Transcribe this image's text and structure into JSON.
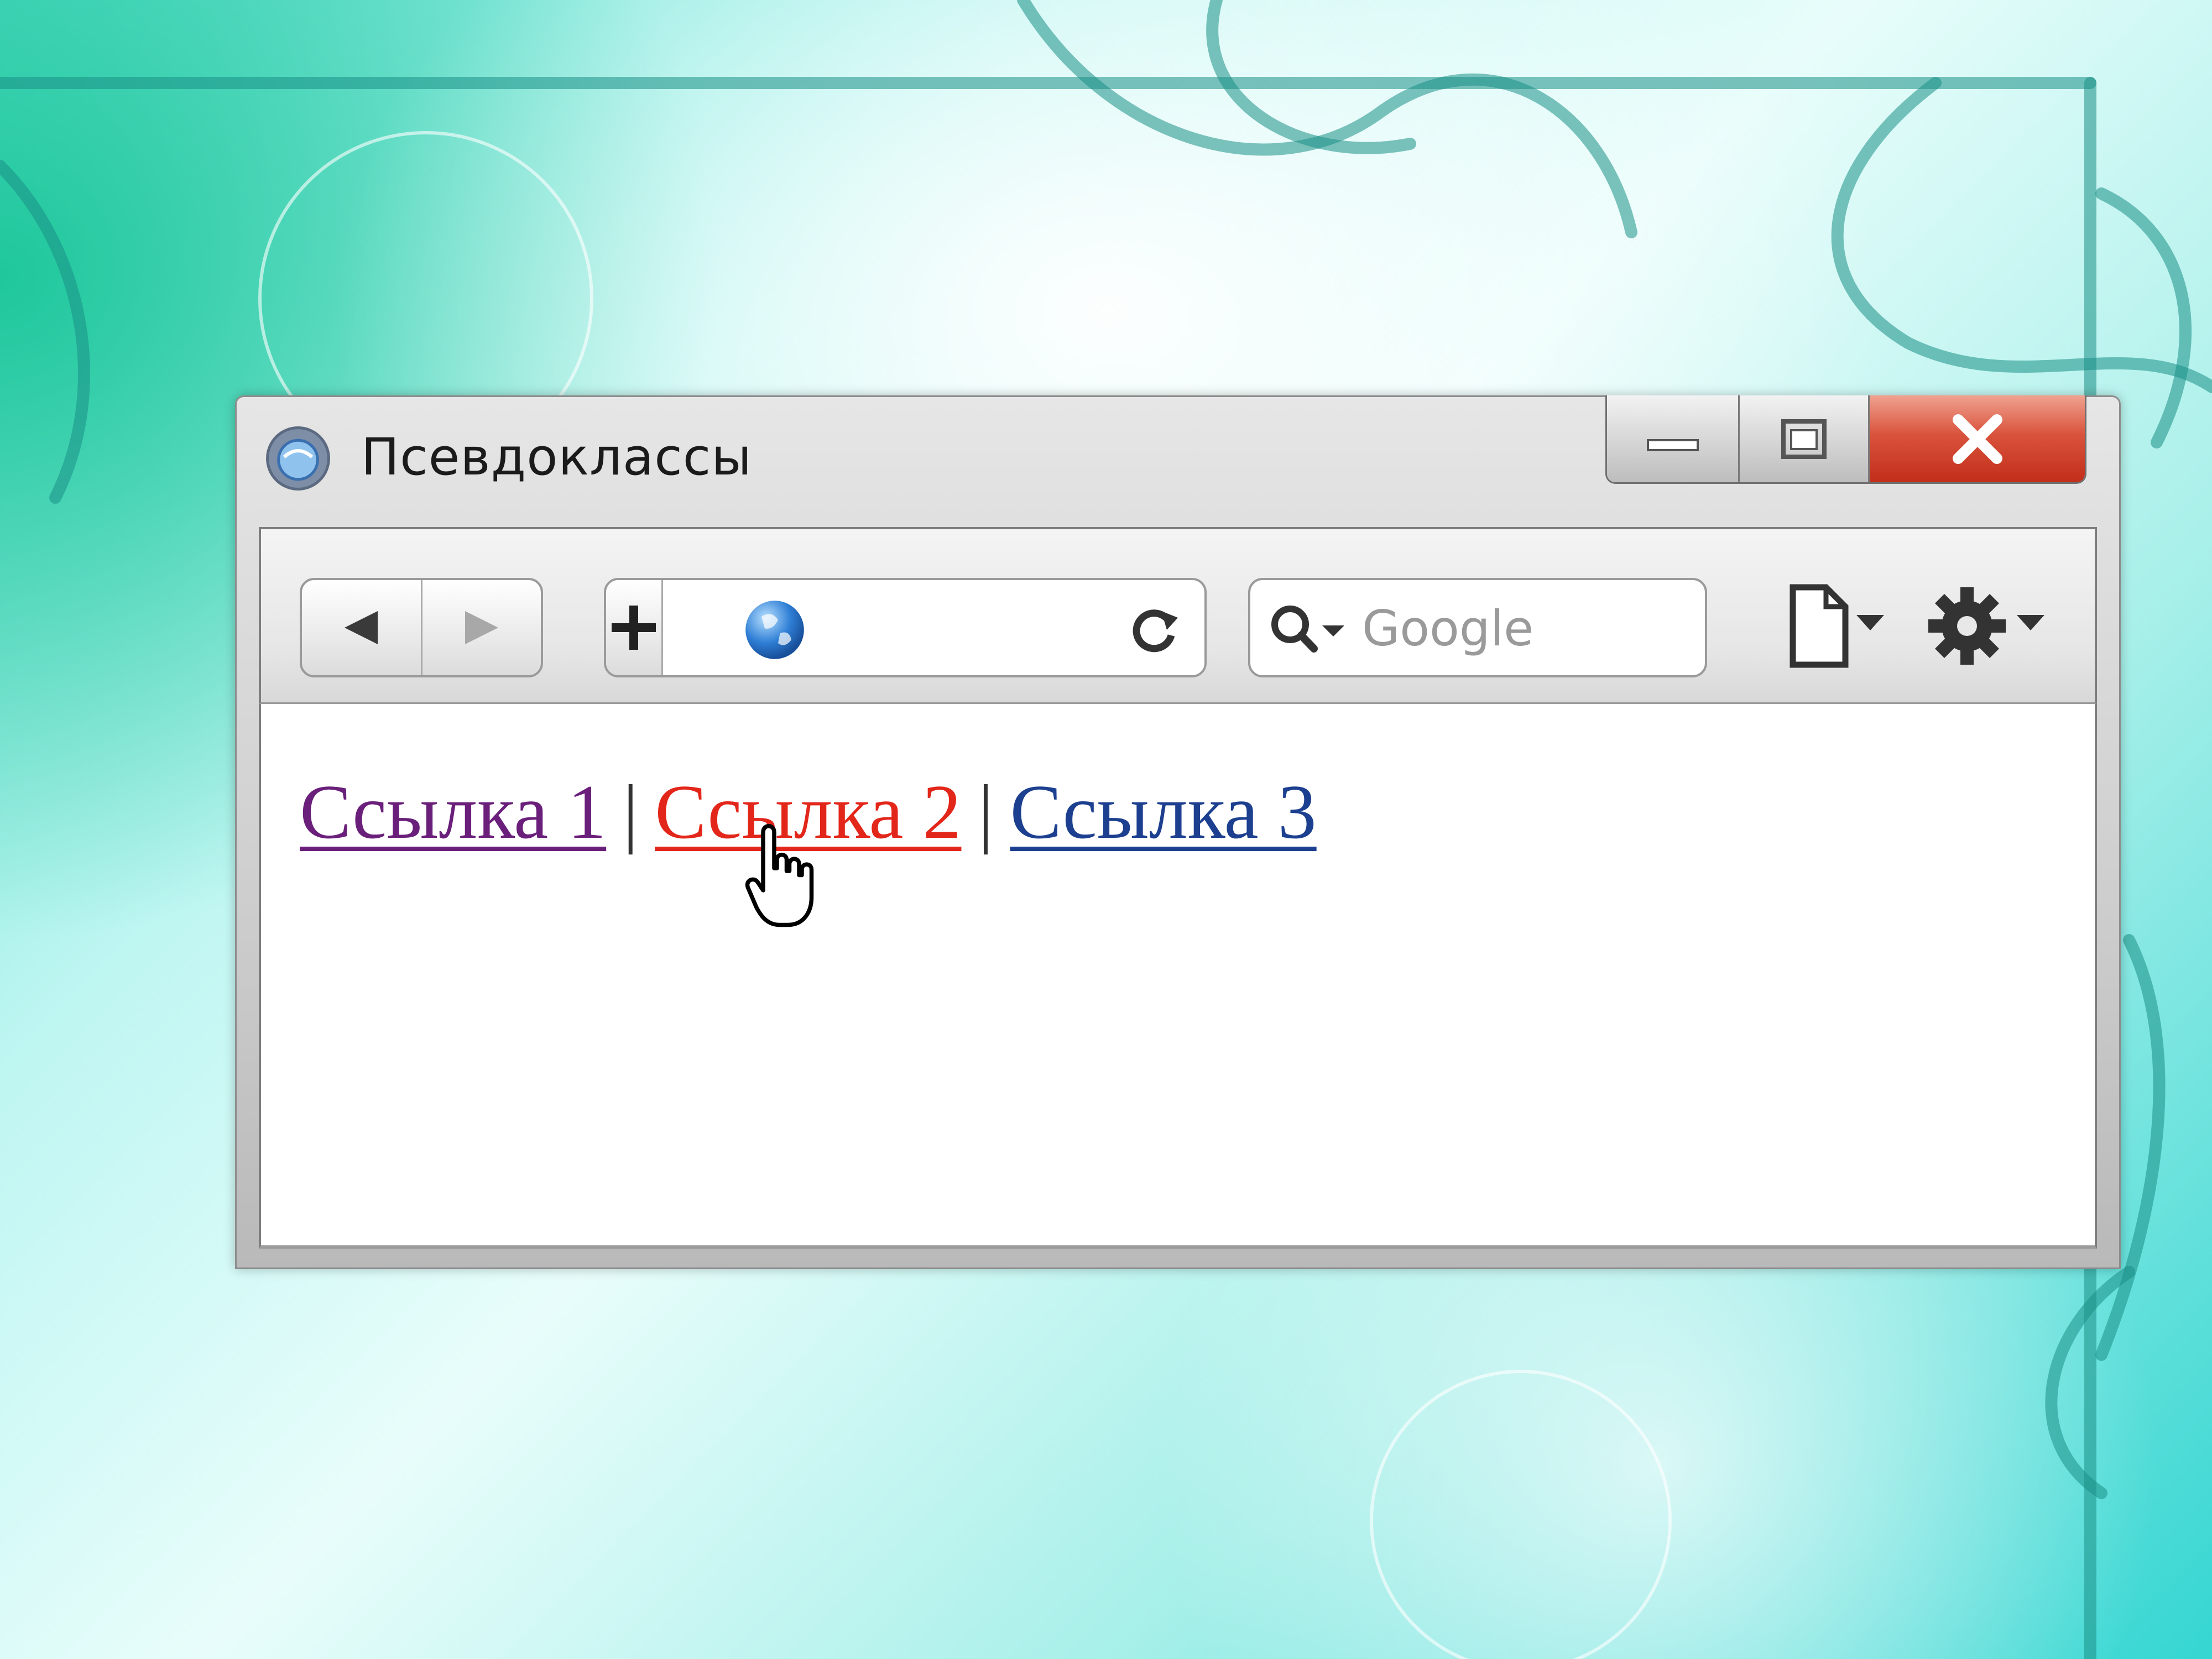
{
  "window": {
    "title": "Псевдоклассы"
  },
  "toolbar": {
    "back_icon": "back-arrow-icon",
    "forward_icon": "forward-arrow-icon",
    "add_icon": "plus-icon",
    "address_value": "",
    "search_placeholder": "Google"
  },
  "content": {
    "links": [
      {
        "label": "Ссылка 1",
        "state": "visited",
        "color": "#6a1f7a"
      },
      {
        "label": "Ссылка 2",
        "state": "hover",
        "color": "#e3261a"
      },
      {
        "label": "Ссылка 3",
        "state": "normal",
        "color": "#1c3f8f"
      }
    ],
    "separator": "|"
  },
  "colors": {
    "close_button": "#c22e1a",
    "accent_teal": "#35d6d2"
  }
}
